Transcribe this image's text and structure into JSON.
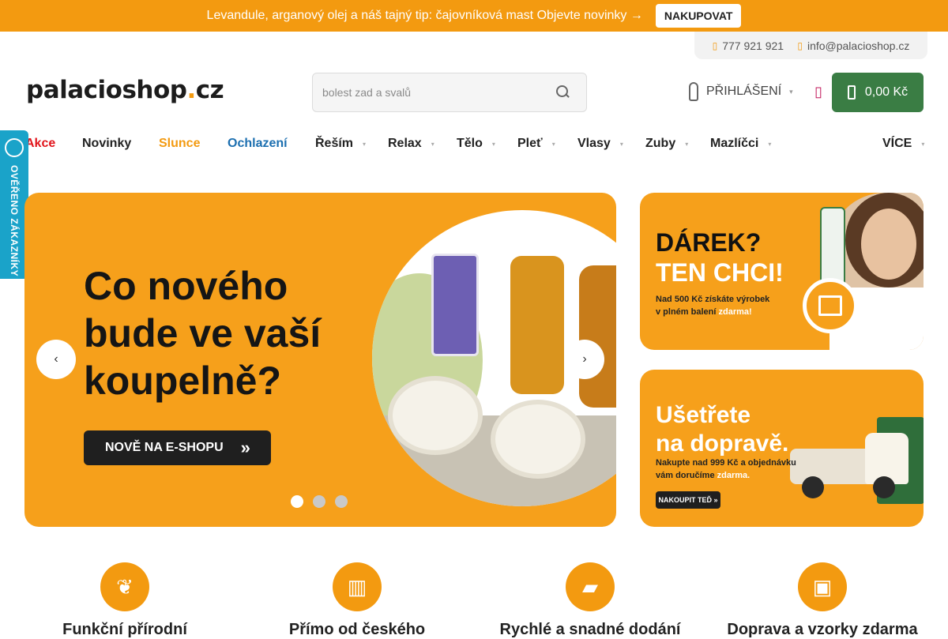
{
  "promo": {
    "text": " Levandule, arganový olej a náš tajný tip: čajovníková mast  Objevte novinky →",
    "button": "NAKUPOVAT"
  },
  "contact": {
    "phone": "777 921 921",
    "email": "info@palacioshop.cz"
  },
  "header": {
    "logo_main": "palacioshop",
    "logo_dot": ".",
    "logo_tld": "cz",
    "search_placeholder": "bolest zad a svalů",
    "login_label": "PŘIHLÁŠENÍ",
    "cart_total": "0,00 Kč"
  },
  "nav": {
    "items": [
      {
        "label": "Akce",
        "color": "#e1141b"
      },
      {
        "label": "Novinky",
        "color": "#222222"
      },
      {
        "label": "Slunce",
        "color": "#f39a10"
      },
      {
        "label": "Ochlazení",
        "color": "#1c6fb0"
      },
      {
        "label": "Řeším",
        "color": "#222222"
      },
      {
        "label": "Relax",
        "color": "#222222"
      },
      {
        "label": "Tělo",
        "color": "#222222"
      },
      {
        "label": "Pleť",
        "color": "#222222"
      },
      {
        "label": "Vlasy",
        "color": "#222222"
      },
      {
        "label": "Zuby",
        "color": "#222222"
      },
      {
        "label": "Mazlíčci",
        "color": "#222222"
      },
      {
        "label": "VÍCE",
        "color": "#222222"
      }
    ]
  },
  "verified": {
    "label": "OVĚŘENO ZÁKAZNÍKY"
  },
  "hero": {
    "heading_lines": [
      "Co nového",
      "bude ve vaší",
      "koupelně?"
    ],
    "cta": "NOVĚ NA E-SHOPU",
    "slide_count": 3,
    "active_slide": 1
  },
  "banners": {
    "gift": {
      "line1": "DÁREK?",
      "line2": "TEN CHCI!",
      "sub_a": "Nad 500 Kč získáte výrobek",
      "sub_b": "v plném balení",
      "sub_c": "zdarma!"
    },
    "shipping": {
      "line1": "Ušetřete",
      "line2": "na dopravě.",
      "sub_a": "Nakupte nad 999 Kč a objednávku",
      "sub_b": "vám doručíme",
      "sub_c": "zdarma.",
      "button": "NAKOUPIT TEĎ"
    }
  },
  "features": [
    {
      "title": "Funkční přírodní",
      "icon": "leaf-icon"
    },
    {
      "title": "Přímo od českého",
      "icon": "factory-icon"
    },
    {
      "title": "Rychlé a snadné dodání",
      "icon": "truck-icon"
    },
    {
      "title": "Doprava a vzorky zdarma",
      "icon": "gift-icon"
    }
  ],
  "colors": {
    "accent": "#f39a10",
    "cart": "#3a7d44",
    "badge": "#1aa3c9"
  }
}
